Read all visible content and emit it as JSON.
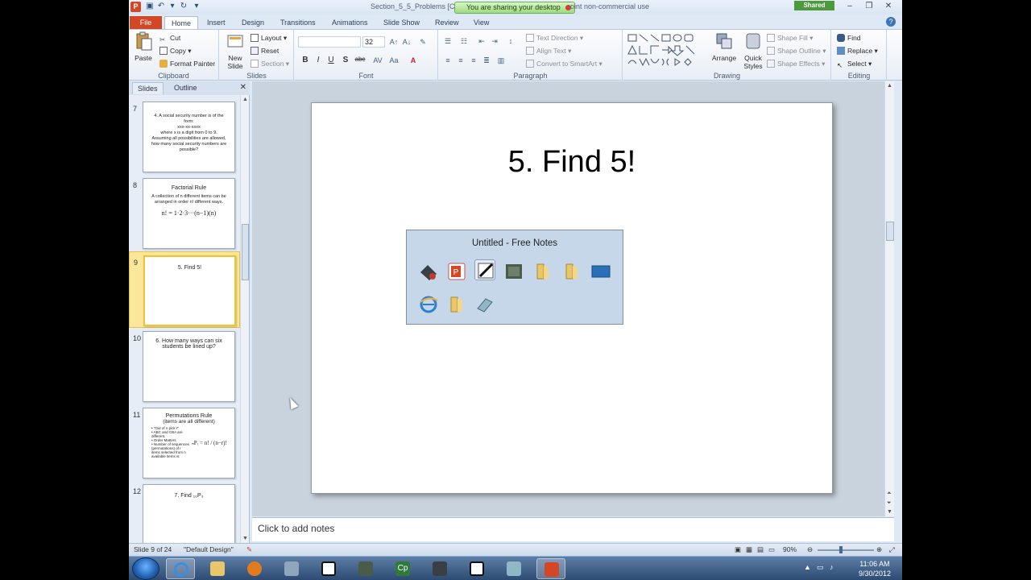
{
  "titlebar": {
    "title_left": "Section_5_5_Problems [C",
    "title_right": "oint non-commercial use",
    "share_banner": "You are sharing your desktop",
    "shared_badge": "Shared"
  },
  "tabs": [
    "File",
    "Home",
    "Insert",
    "Design",
    "Transitions",
    "Animations",
    "Slide Show",
    "Review",
    "View"
  ],
  "ribbon": {
    "clipboard": {
      "paste": "Paste",
      "cut": "Cut",
      "copy": "Copy",
      "format_painter": "Format Painter",
      "label": "Clipboard"
    },
    "slides": {
      "new_slide_1": "New",
      "new_slide_2": "Slide",
      "layout": "Layout",
      "reset": "Reset",
      "section": "Section",
      "label": "Slides"
    },
    "font": {
      "size": "32",
      "label": "Font",
      "bold": "B",
      "italic": "I",
      "underline": "U",
      "strike": "S",
      "shadow": "abc"
    },
    "paragraph": {
      "text_direction": "Text Direction",
      "align_text": "Align Text",
      "convert_smartart": "Convert to SmartArt",
      "label": "Paragraph"
    },
    "drawing": {
      "arrange": "Arrange",
      "quick_styles_1": "Quick",
      "quick_styles_2": "Styles",
      "shape_fill": "Shape Fill",
      "shape_outline": "Shape Outline",
      "shape_effects": "Shape Effects",
      "label": "Drawing"
    },
    "editing": {
      "find": "Find",
      "replace": "Replace",
      "select": "Select",
      "label": "Editing"
    }
  },
  "left_pane": {
    "tabs": [
      "Slides",
      "Outline"
    ],
    "thumbnails": [
      {
        "num": "7",
        "lines": [
          "4.  A social security number is of the",
          "form:",
          "xxx-xx-xxxx",
          "where  x is a digit from 0 to 9.",
          "Assuming all possibilities are allowed,",
          "how many social security numbers  are",
          "possible?"
        ]
      },
      {
        "num": "8",
        "title": "Factorial Rule",
        "lines": [
          "A collection of n different items can be",
          "arranged in order n! different ways."
        ],
        "eq": "n! = 1·2·3···(n−1)(n)"
      },
      {
        "num": "9",
        "title": "5.  Find 5!"
      },
      {
        "num": "10",
        "title": "6.  How many ways can six",
        "title2": "students be lined up?"
      },
      {
        "num": "11",
        "title": "Permutations  Rule",
        "title2": "(items  are all different)",
        "lines": [
          "• \"Out of n pick r\"",
          "• ABC and CBA are",
          "  different.",
          "• Order Matters",
          "• Number of sequences",
          "  (permutations) of r",
          "  items selected from n",
          "  available items is:"
        ],
        "eq": "ₙPᵣ = n! / (n−r)!"
      },
      {
        "num": "12",
        "title": "7.  Find ₁₀P₃"
      }
    ]
  },
  "slide": {
    "title": "5.  Find 5!",
    "popup_title": "Untitled - Free Notes"
  },
  "notes": {
    "placeholder": "Click to add notes"
  },
  "status": {
    "slide_of": "Slide 9 of 24",
    "theme": "\"Default Design\"",
    "zoom": "90%"
  },
  "taskbar": {
    "time": "11:06 AM",
    "date": "9/30/2012",
    "cp_label": "Cp"
  },
  "colors": {
    "accent": "#d24726",
    "ribbon": "#e8eef6",
    "selected_thumb": "#fbe79a"
  }
}
